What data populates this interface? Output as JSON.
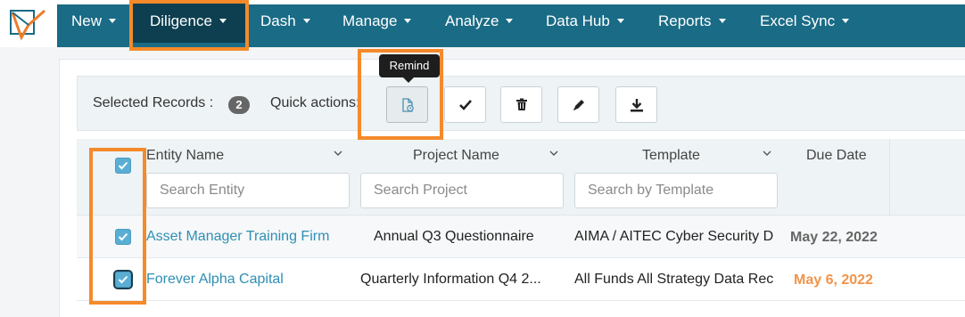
{
  "nav": {
    "items": [
      {
        "label": "New"
      },
      {
        "label": "Diligence"
      },
      {
        "label": "Dash"
      },
      {
        "label": "Manage"
      },
      {
        "label": "Analyze"
      },
      {
        "label": "Data Hub"
      },
      {
        "label": "Reports"
      },
      {
        "label": "Excel Sync"
      }
    ],
    "active": "Diligence"
  },
  "toolbar": {
    "selected_label": "Selected Records :",
    "selected_count": "2",
    "quick_actions_label": "Quick actions:",
    "actions": [
      {
        "icon": "remind-document-icon",
        "tooltip": "Remind",
        "pressed": true
      },
      {
        "icon": "check-icon"
      },
      {
        "icon": "trash-icon"
      },
      {
        "icon": "pencil-icon"
      },
      {
        "icon": "download-icon"
      }
    ]
  },
  "table": {
    "select_all_checked": true,
    "columns": [
      {
        "label": "Entity Name",
        "filter_placeholder": "Search Entity"
      },
      {
        "label": "Project Name",
        "filter_placeholder": "Search Project"
      },
      {
        "label": "Template",
        "filter_placeholder": "Search by Template"
      },
      {
        "label": "Due Date"
      }
    ],
    "rows": [
      {
        "checked": true,
        "entity": "Asset Manager Training Firm",
        "project": "Annual Q3 Questionnaire",
        "template": "AIMA / AITEC Cyber Security D",
        "due": "May 22, 2022",
        "overdue": false
      },
      {
        "checked": true,
        "entity": "Forever Alpha Capital",
        "project": "Quarterly Information Q4 2...",
        "template": "All Funds All Strategy Data Rec",
        "due": "May 6, 2022",
        "overdue": true
      }
    ]
  },
  "colors": {
    "nav_bg": "#1a6b85",
    "nav_active_bg": "#0d3f50",
    "highlight": "#f58a2b",
    "link": "#2f8fb5",
    "checkbox": "#5aaed4",
    "overdue_date": "#f0944b"
  }
}
